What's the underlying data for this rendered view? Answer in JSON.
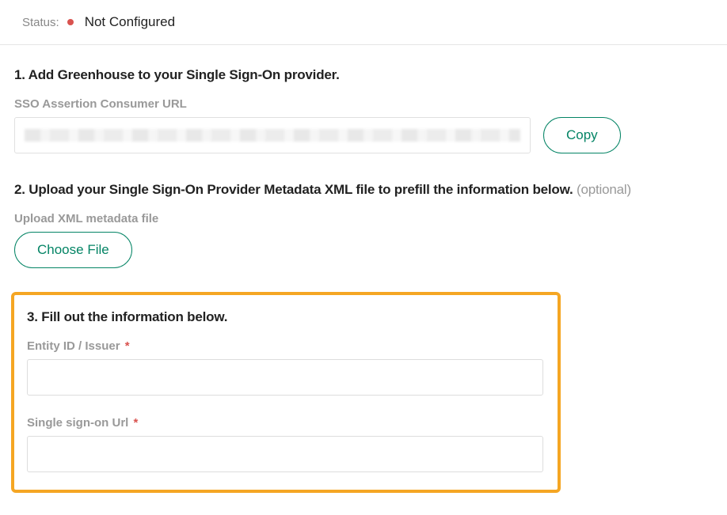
{
  "status": {
    "label": "Status:",
    "value": "Not Configured"
  },
  "section1": {
    "heading": "1. Add Greenhouse to your Single Sign-On provider.",
    "sso_url_label": "SSO Assertion Consumer URL",
    "copy_label": "Copy"
  },
  "section2": {
    "heading_main": "2. Upload your Single Sign-On Provider Metadata XML file to prefill the information below. ",
    "heading_optional": "(optional)",
    "upload_label": "Upload XML metadata file",
    "choose_file_label": "Choose File"
  },
  "section3": {
    "heading": "3. Fill out the information below.",
    "entity_id_label": "Entity ID / Issuer",
    "sso_url_label": "Single sign-on Url",
    "required_mark": "*"
  }
}
